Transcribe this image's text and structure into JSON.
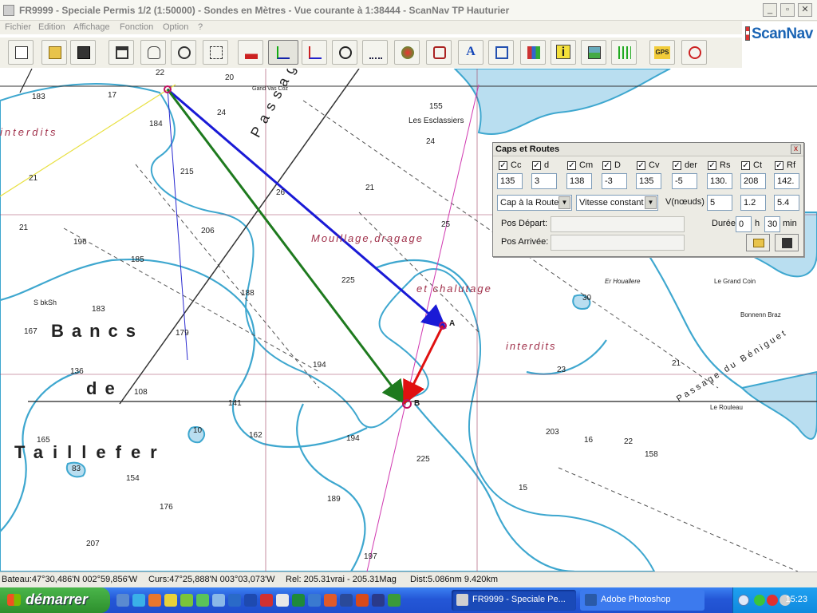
{
  "window": {
    "title": "FR9999 - Speciale Permis 1/2 (1:50000) - Sondes en  Mètres  - Vue courante à 1:38444 - ScanNav TP Hauturier",
    "minimize": "_",
    "maximize": "▫",
    "close": "✕"
  },
  "menu": [
    "Fichier",
    "Edition",
    "Affichage",
    "Fonction",
    "Option",
    "?"
  ],
  "logo": "ScanNav",
  "toolbar": {
    "text_tool_glyph": "A",
    "info_tool_glyph": "i",
    "gps_tool_label": "GPS"
  },
  "map": {
    "labels": [
      "Bancs",
      "de",
      "Taillefer",
      "Passage",
      "Mouillage,dragage",
      "et chalutage",
      "interdits",
      "interdits",
      "Les Esclassiers",
      "Er Houallere",
      "Le Grand Coin",
      "Bonnenn Braz",
      "Le Rouleau",
      "Passage du Béniguet",
      "B",
      "A",
      "S bkSh",
      "Gand Vas Coz"
    ],
    "soundings": [
      "22",
      "20",
      "17",
      "183",
      "184",
      "24",
      "215",
      "21",
      "26",
      "24",
      "21",
      "25",
      "21",
      "196",
      "185",
      "206",
      "225",
      "155",
      "183",
      "167",
      "179",
      "188",
      "136",
      "194",
      "108",
      "141",
      "165",
      "10",
      "162",
      "194",
      "225",
      "203",
      "83",
      "154",
      "176",
      "189",
      "16",
      "22",
      "158",
      "197",
      "207",
      "30",
      "23",
      "21",
      "15"
    ],
    "point_a": "A",
    "point_b": "B"
  },
  "dialog": {
    "title": "Caps et Routes",
    "close": "x",
    "columns": [
      {
        "label": "Cc",
        "value": "135"
      },
      {
        "label": "d",
        "value": "3"
      },
      {
        "label": "Cm",
        "value": "138"
      },
      {
        "label": "D",
        "value": "-3"
      },
      {
        "label": "Cv",
        "value": "135"
      },
      {
        "label": "der",
        "value": "-5"
      },
      {
        "label": "Rs",
        "value": "130."
      },
      {
        "label": "Ct",
        "value": "208"
      },
      {
        "label": "Rf",
        "value": "142."
      }
    ],
    "check_mark": "✓",
    "mode_select": "Cap à la Route",
    "speed_select": "Vitesse constant",
    "speed_label": "V(nœuds)",
    "speed_values": [
      "5",
      "1.2",
      "5.4"
    ],
    "pos_depart_label": "Pos Départ:",
    "pos_arrivee_label": "Pos Arrivée:",
    "duree_label": "Durée",
    "hours": "0",
    "h_label": "h",
    "minutes": "30",
    "min_label": "min"
  },
  "status": {
    "bateau": "Bateau:47°30,486'N 002°59,856'W",
    "curs": "Curs:47°25,888'N 003°03,073'W",
    "rel": "Rel: 205.31vrai - 205.31Mag",
    "dist": "Dist:5.086nm  9.420km"
  },
  "taskbar": {
    "start_label": "démarrer",
    "tasks": [
      "FR9999 - Speciale Pe...",
      "Adobe Photoshop"
    ],
    "clock": "15:23"
  },
  "colors": {
    "route_blue": "#1a1ad6",
    "route_green": "#1e7a1e",
    "route_red": "#e01010",
    "shallow_water": "#a9d7ea"
  }
}
